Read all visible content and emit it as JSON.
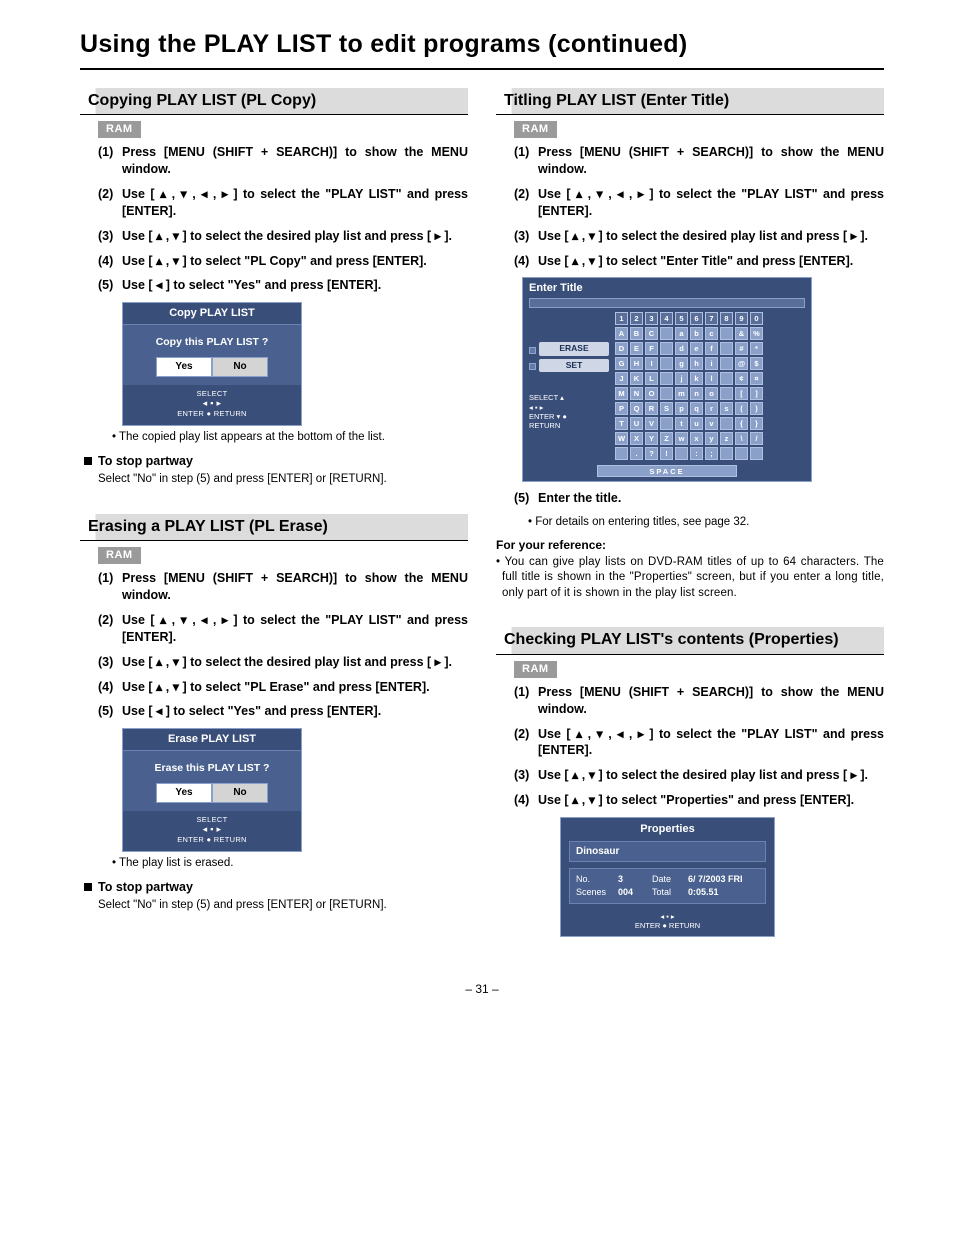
{
  "page_title": "Using the PLAY LIST to edit programs (continued)",
  "page_number": "– 31 –",
  "ram_label": "RAM",
  "arrows": {
    "up": "▴",
    "down": "▾",
    "left": "◂",
    "right": "▸"
  },
  "sec_copy": {
    "title": "Copying PLAY LIST (PL Copy)",
    "steps": [
      {
        "n": "(1)",
        "t": "Press [MENU (SHIFT + SEARCH)] to show the MENU window."
      },
      {
        "n": "(2)",
        "t": "Use [ ▴ ,  ▾ ,  ◂ ,  ▸ ] to select the \"PLAY LIST\" and press [ENTER]."
      },
      {
        "n": "(3)",
        "t": "Use [ ▴ ,  ▾ ] to select the desired play list and press [ ▸ ]."
      },
      {
        "n": "(4)",
        "t": "Use [ ▴ ,  ▾ ] to select \"PL Copy\" and press [ENTER]."
      },
      {
        "n": "(5)",
        "t": "Use [ ◂ ] to select \"Yes\" and press [ENTER]."
      }
    ],
    "dialog": {
      "title": "Copy PLAY LIST",
      "question": "Copy this PLAY LIST ?",
      "yes": "Yes",
      "no": "No",
      "foot1": "SELECT",
      "foot2": "◂ ▪ ▸",
      "foot3": "ENTER   ●  RETURN"
    },
    "after_note": "• The copied play list appears at the bottom of the list.",
    "stop_head": "To stop partway",
    "stop_body": "Select \"No\" in step (5) and press [ENTER] or [RETURN]."
  },
  "sec_erase": {
    "title": "Erasing a PLAY LIST (PL Erase)",
    "steps": [
      {
        "n": "(1)",
        "t": "Press [MENU (SHIFT + SEARCH)] to show the MENU window."
      },
      {
        "n": "(2)",
        "t": "Use [ ▴ ,  ▾ ,  ◂ ,  ▸ ] to select the \"PLAY LIST\" and press [ENTER]."
      },
      {
        "n": "(3)",
        "t": "Use [ ▴ ,  ▾ ] to select the desired play list and press [ ▸ ]."
      },
      {
        "n": "(4)",
        "t": "Use [ ▴ ,  ▾ ] to select \"PL Erase\" and press [ENTER]."
      },
      {
        "n": "(5)",
        "t": "Use [ ◂ ] to select \"Yes\" and press [ENTER]."
      }
    ],
    "dialog": {
      "title": "Erase PLAY LIST",
      "question": "Erase this PLAY LIST ?",
      "yes": "Yes",
      "no": "No",
      "foot1": "SELECT",
      "foot2": "◂ ▪ ▸",
      "foot3": "ENTER   ●  RETURN"
    },
    "after_note": "• The play list is erased.",
    "stop_head": "To stop partway",
    "stop_body": "Select \"No\" in step (5) and press [ENTER] or [RETURN]."
  },
  "sec_title": {
    "title": "Titling PLAY LIST (Enter Title)",
    "steps": [
      {
        "n": "(1)",
        "t": "Press [MENU (SHIFT + SEARCH)] to show the MENU window."
      },
      {
        "n": "(2)",
        "t": "Use [ ▴ ,  ▾ ,  ◂ ,  ▸ ] to select the \"PLAY LIST\" and press [ENTER]."
      },
      {
        "n": "(3)",
        "t": "Use [ ▴ ,  ▾ ] to select the desired play list and press [ ▸ ]."
      },
      {
        "n": "(4)",
        "t": "Use [ ▴ ,  ▾ ] to select \"Enter Title\" and press [ENTER]."
      }
    ],
    "dialog": {
      "title": "Enter Title",
      "erase": "ERASE",
      "set": "SET",
      "nav1": "SELECT ▴",
      "nav2": "◂ ▪ ▸",
      "nav3": "ENTER ▾   ●",
      "nav4": "RETURN",
      "rows": [
        [
          "1",
          "2",
          "3",
          "4",
          "5",
          "6",
          "7",
          "8",
          "9",
          "0"
        ],
        [
          "A",
          "B",
          "C",
          "",
          "a",
          "b",
          "c",
          "",
          "&",
          "%"
        ],
        [
          "D",
          "E",
          "F",
          "",
          "d",
          "e",
          "f",
          "",
          "#",
          "*"
        ],
        [
          "G",
          "H",
          "I",
          "",
          "g",
          "h",
          "i",
          "",
          "@",
          "$"
        ],
        [
          "J",
          "K",
          "L",
          "",
          "j",
          "k",
          "l",
          "",
          "¢",
          "¤"
        ],
        [
          "M",
          "N",
          "O",
          "",
          "m",
          "n",
          "o",
          "",
          "[",
          "]"
        ],
        [
          "P",
          "Q",
          "R",
          "S",
          "p",
          "q",
          "r",
          "s",
          "(",
          ")"
        ],
        [
          "T",
          "U",
          "V",
          "",
          "t",
          "u",
          "v",
          "",
          "{",
          "}"
        ],
        [
          "W",
          "X",
          "Y",
          "Z",
          "w",
          "x",
          "y",
          "z",
          "\\",
          "/"
        ],
        [
          "",
          ".",
          "?",
          "!",
          "",
          ":",
          ";",
          "",
          "",
          ""
        ]
      ],
      "space": "SPACE"
    },
    "step5": {
      "n": "(5)",
      "t": "Enter the title."
    },
    "step5_note": "• For details on entering titles, see page 32.",
    "ref_head": "For your reference:",
    "ref_body": "You can give play lists on DVD-RAM titles of up to 64 characters. The full title is shown in the \"Properties\" screen, but if you enter a long title, only part of it is shown in the play list screen."
  },
  "sec_props": {
    "title": "Checking PLAY LIST's contents (Properties)",
    "steps": [
      {
        "n": "(1)",
        "t": "Press [MENU (SHIFT + SEARCH)] to show the MENU window."
      },
      {
        "n": "(2)",
        "t": "Use [ ▴ ,  ▾ ,  ◂ ,  ▸ ] to select the \"PLAY LIST\" and press [ENTER]."
      },
      {
        "n": "(3)",
        "t": "Use [ ▴ ,  ▾ ] to select the desired play list and press [ ▸ ]."
      },
      {
        "n": "(4)",
        "t": "Use [ ▴ ,  ▾ ] to select \"Properties\" and press [ENTER]."
      }
    ],
    "dialog": {
      "title": "Properties",
      "name": "Dinosaur",
      "no_lbl": "No.",
      "no_val": "3",
      "date_lbl": "Date",
      "date_val": "6/ 7/2003 FRI",
      "scenes_lbl": "Scenes",
      "scenes_val": "004",
      "total_lbl": "Total",
      "total_val": "0:05.51",
      "foot1": "◂ ▪ ▸",
      "foot2": "ENTER   ●  RETURN"
    }
  }
}
